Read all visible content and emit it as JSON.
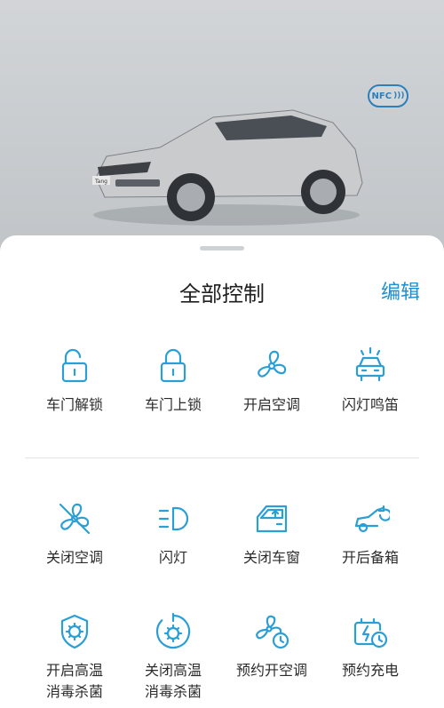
{
  "hero": {
    "nfc_label": "NFC",
    "car_badge": "Tang"
  },
  "sheet": {
    "title": "全部控制",
    "edit_label": "编辑"
  },
  "controls": [
    {
      "label": "车门解锁",
      "icon": "unlock-icon"
    },
    {
      "label": "车门上锁",
      "icon": "lock-icon"
    },
    {
      "label": "开启空调",
      "icon": "fan-icon"
    },
    {
      "label": "闪灯鸣笛",
      "icon": "car-horn-icon"
    },
    {
      "label": "关闭空调",
      "icon": "fan-off-icon"
    },
    {
      "label": "闪灯",
      "icon": "headlight-icon"
    },
    {
      "label": "关闭车窗",
      "icon": "car-window-icon"
    },
    {
      "label": "开后备箱",
      "icon": "trunk-icon"
    },
    {
      "label": "开启高温\n消毒杀菌",
      "icon": "shield-virus-icon"
    },
    {
      "label": "关闭高温\n消毒杀菌",
      "icon": "virus-off-icon"
    },
    {
      "label": "预约开空调",
      "icon": "fan-clock-icon"
    },
    {
      "label": "预约充电",
      "icon": "battery-clock-icon"
    }
  ],
  "colors": {
    "accent": "#1e8fd0",
    "icon": "#2a9fd6"
  }
}
